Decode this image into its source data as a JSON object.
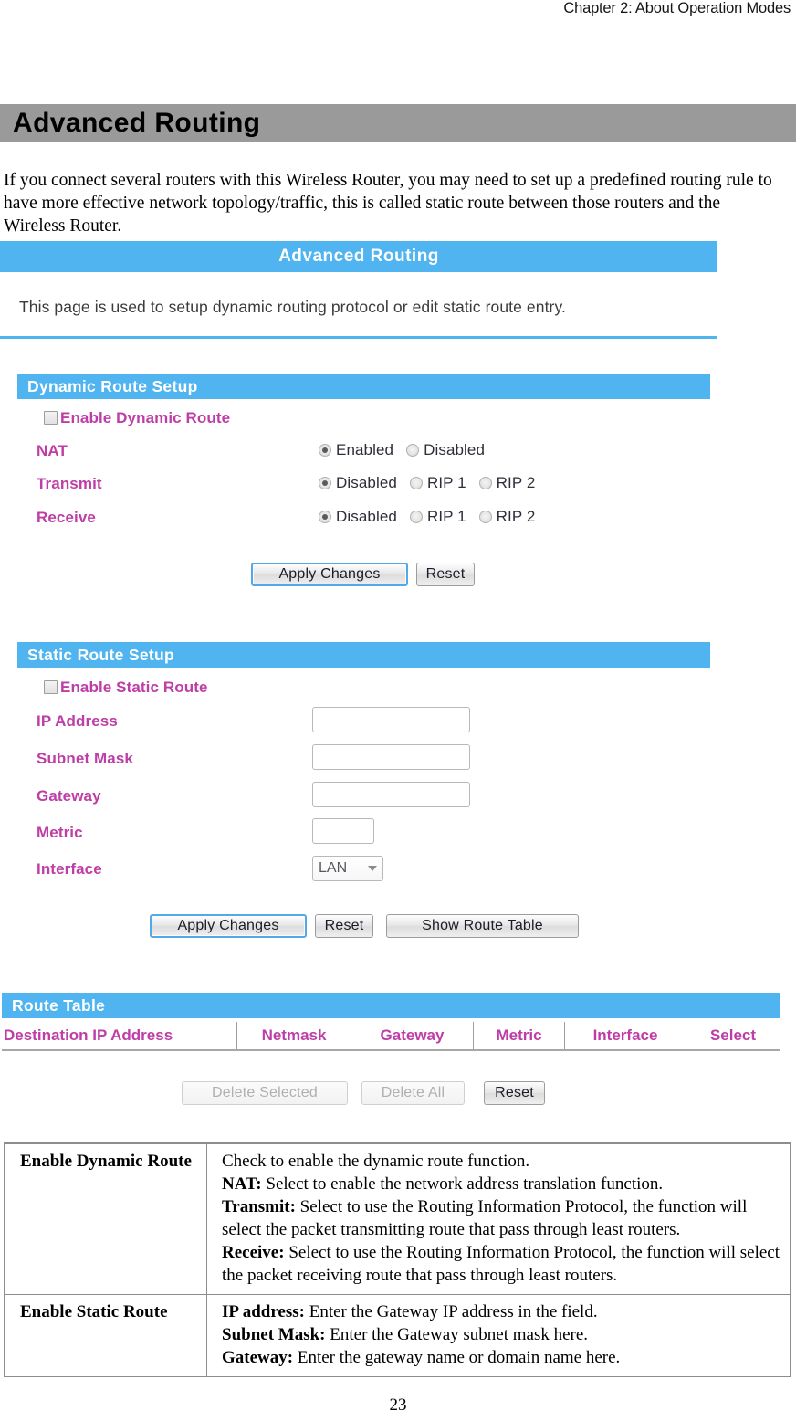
{
  "running_head": "Chapter 2: About Operation Modes",
  "section": {
    "title": "Advanced Routing"
  },
  "intro_paragraph": "If you connect several routers with this Wireless Router, you may need to set up a predefined routing rule to have more effective network topology/traffic, this is called static route between those routers and the Wireless Router.",
  "router_ui": {
    "page_title": "Advanced Routing",
    "page_description": "This page is used to setup dynamic routing protocol or edit static route entry.",
    "dynamic_route": {
      "panel_title": "Dynamic Route Setup",
      "enable_label": "Enable Dynamic Route",
      "enable_checked": false,
      "rows": [
        {
          "label": "NAT",
          "options": [
            {
              "label": "Enabled",
              "selected": true
            },
            {
              "label": "Disabled",
              "selected": false
            }
          ]
        },
        {
          "label": "Transmit",
          "options": [
            {
              "label": "Disabled",
              "selected": true
            },
            {
              "label": "RIP 1",
              "selected": false
            },
            {
              "label": "RIP 2",
              "selected": false
            }
          ]
        },
        {
          "label": "Receive",
          "options": [
            {
              "label": "Disabled",
              "selected": true
            },
            {
              "label": "RIP 1",
              "selected": false
            },
            {
              "label": "RIP 2",
              "selected": false
            }
          ]
        }
      ],
      "apply_label": "Apply Changes",
      "reset_label": "Reset"
    },
    "static_route": {
      "panel_title": "Static Route Setup",
      "enable_label": "Enable Static Route",
      "enable_checked": false,
      "fields": [
        {
          "label": "IP Address",
          "value": "",
          "placeholder": ""
        },
        {
          "label": "Subnet Mask",
          "value": "",
          "placeholder": ""
        },
        {
          "label": "Gateway",
          "value": "",
          "placeholder": ""
        },
        {
          "label": "Metric",
          "value": "",
          "placeholder": ""
        }
      ],
      "interface_label": "Interface",
      "interface_value": "LAN",
      "apply_label": "Apply Changes",
      "reset_label": "Reset",
      "show_route_table_label": "Show Route Table"
    },
    "route_table": {
      "panel_title": "Route Table",
      "columns": [
        "Destination IP Address",
        "Netmask",
        "Gateway",
        "Metric",
        "Interface",
        "Select"
      ],
      "rows": [],
      "delete_selected_label": "Delete Selected",
      "delete_selected_disabled": true,
      "delete_all_label": "Delete All",
      "delete_all_disabled": true,
      "reset_label": "Reset"
    },
    "colors": {
      "accent_blue": "#4FB4F0",
      "label_magenta": "#BE3DA6",
      "section_bar_gray": "#9A9A9A"
    }
  },
  "description_table": {
    "rows": [
      {
        "term": "Enable Dynamic Route",
        "lines": [
          {
            "bold": "",
            "text": "Check to enable the dynamic route function."
          },
          {
            "bold": "NAT:",
            "text": " Select to enable the network address translation function."
          },
          {
            "bold": "Transmit:",
            "text": " Select to use the Routing Information Protocol, the function will select the packet transmitting route that pass through least routers."
          },
          {
            "bold": "Receive:",
            "text": " Select to use the Routing Information Protocol, the function will select the packet receiving route that pass through least routers."
          }
        ]
      },
      {
        "term": "Enable Static Route",
        "lines": [
          {
            "bold": "IP address:",
            "text": " Enter the Gateway IP address in the field."
          },
          {
            "bold": "Subnet Mask:",
            "text": " Enter the Gateway subnet mask here."
          },
          {
            "bold": "Gateway:",
            "text": " Enter the gateway name or domain name here."
          }
        ]
      }
    ]
  },
  "page_number": "23"
}
